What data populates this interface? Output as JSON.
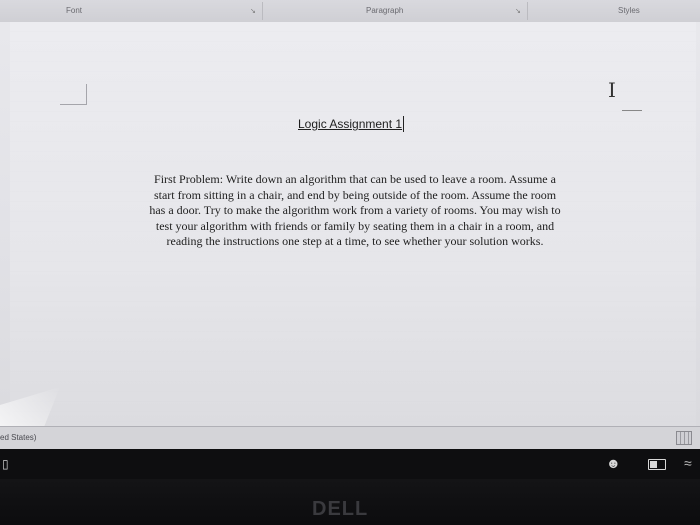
{
  "ribbon": {
    "groups": [
      {
        "label": "Font"
      },
      {
        "label": "Paragraph"
      },
      {
        "label": "Styles"
      }
    ]
  },
  "document": {
    "title": "Logic Assignment 1",
    "body_lines": [
      "First Problem: Write down an algorithm that can be used to leave a room. Assume a",
      "start from sitting in a chair, and end by being outside of the room. Assume the room",
      "has a door. Try to make the algorithm work from a variety of rooms. You may wish to",
      "test your algorithm with friends or family by seating them in a chair in a room, and",
      "reading the instructions one step at a time, to see whether your solution works."
    ]
  },
  "statusbar": {
    "language": "ed States)"
  },
  "taskbar": {
    "icons": [
      "window-icon",
      "people-icon",
      "battery-icon",
      "wifi-icon"
    ]
  },
  "bezel": {
    "logo": "DELL"
  }
}
